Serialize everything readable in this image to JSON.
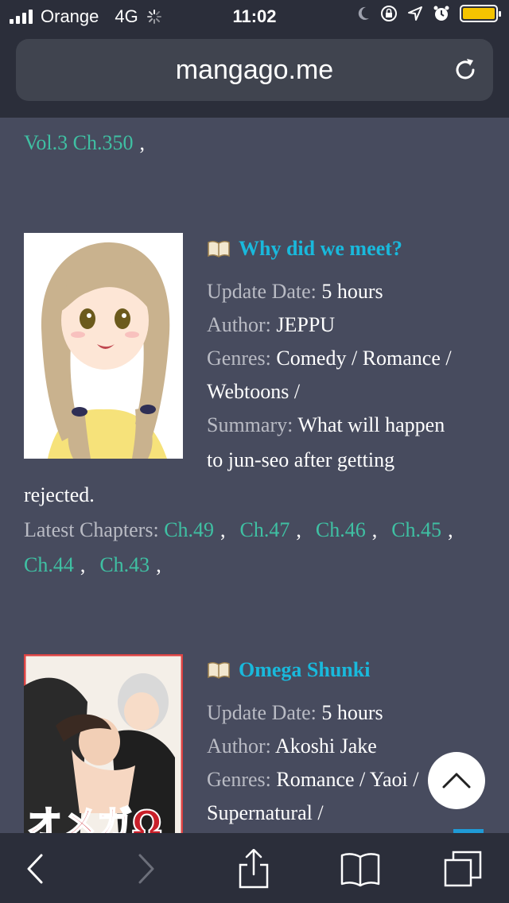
{
  "status_bar": {
    "carrier": "Orange",
    "network": "4G",
    "time": "11:02",
    "battery_color": "#f5c400"
  },
  "browser": {
    "url": "mangago.me"
  },
  "partial_entry": {
    "chapters": [
      "Vol.3 Ch.350"
    ]
  },
  "entries": [
    {
      "title": "Why did we meet?",
      "update_label": "Update Date:",
      "update_value": "5 hours",
      "author_label": "Author:",
      "author_value": "JEPPU",
      "genres_label": "Genres:",
      "genres_line1": "Comedy / Romance /",
      "genres_line2": "Webtoons /",
      "summary_label": "Summary:",
      "summary_line1": "What will happen",
      "summary_line2": "to jun-seo after getting",
      "summary_line3": "rejected.",
      "latest_label": "Latest Chapters:",
      "chapters": [
        "Ch.49",
        "Ch.47",
        "Ch.46",
        "Ch.45",
        "Ch.44",
        "Ch.43"
      ]
    },
    {
      "title": "Omega Shunki",
      "update_label": "Update Date:",
      "update_value": "5 hours",
      "author_label": "Author:",
      "author_value": "Akoshi Jake",
      "genres_label": "Genres:",
      "genres_line1": "Romance / Yaoi /",
      "genres_line2": "Supernatural /",
      "cover_text": "オメガΩ"
    }
  ],
  "separator": ",",
  "icons": {
    "book": "book-icon",
    "reload": "reload-icon",
    "scroll_top": "chevron-up-icon",
    "back": "back-icon",
    "forward": "forward-icon",
    "share": "share-icon",
    "bookmarks": "bookmarks-icon",
    "tabs": "tabs-icon"
  },
  "colors": {
    "link_teal": "#3fc0a3",
    "title_blue": "#19b9dc",
    "background": "#474b5e",
    "bar": "#2b2e3a"
  }
}
